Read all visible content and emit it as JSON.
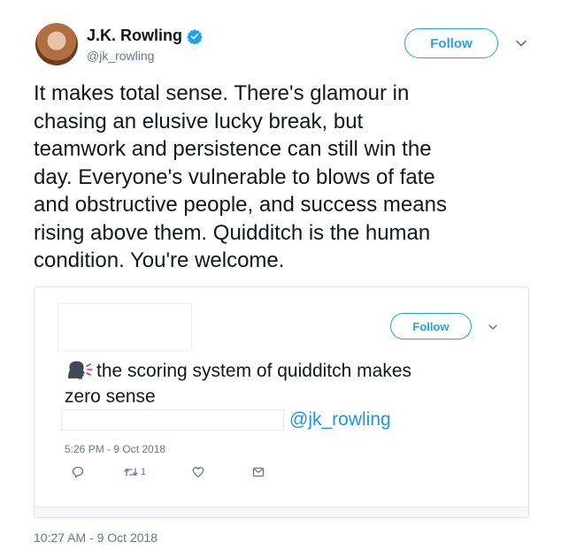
{
  "author": {
    "display_name": "J.K. Rowling",
    "handle": "@jk_rowling",
    "verified": true
  },
  "follow_label": "Follow",
  "tweet": {
    "text": "It makes total sense. There's glamour in\nchasing an elusive lucky break, but\nteamwork and persistence can still win the\nday. Everyone's vulnerable to blows of fate\nand obstructive people, and success means\nrising above them. Quidditch is the human\ncondition. You're welcome.",
    "timestamp": "10:27 AM - 9 Oct 2018"
  },
  "quoted_tweet": {
    "follow_label": "Follow",
    "text_line1": "the scoring system of quidditch makes",
    "text_line2": "zero sense",
    "mention": "@jk_rowling",
    "time": "5:26 PM - 9 Oct 2018",
    "retweet_count": "1"
  },
  "colors": {
    "accent": "#1da1f2",
    "link": "#1b95e0",
    "muted": "#657786",
    "text": "#14171a"
  },
  "icons": [
    "verified-badge-icon",
    "chevron-down-icon",
    "speaking-head-icon",
    "reply-icon",
    "retweet-icon",
    "like-icon",
    "direct-message-icon"
  ]
}
